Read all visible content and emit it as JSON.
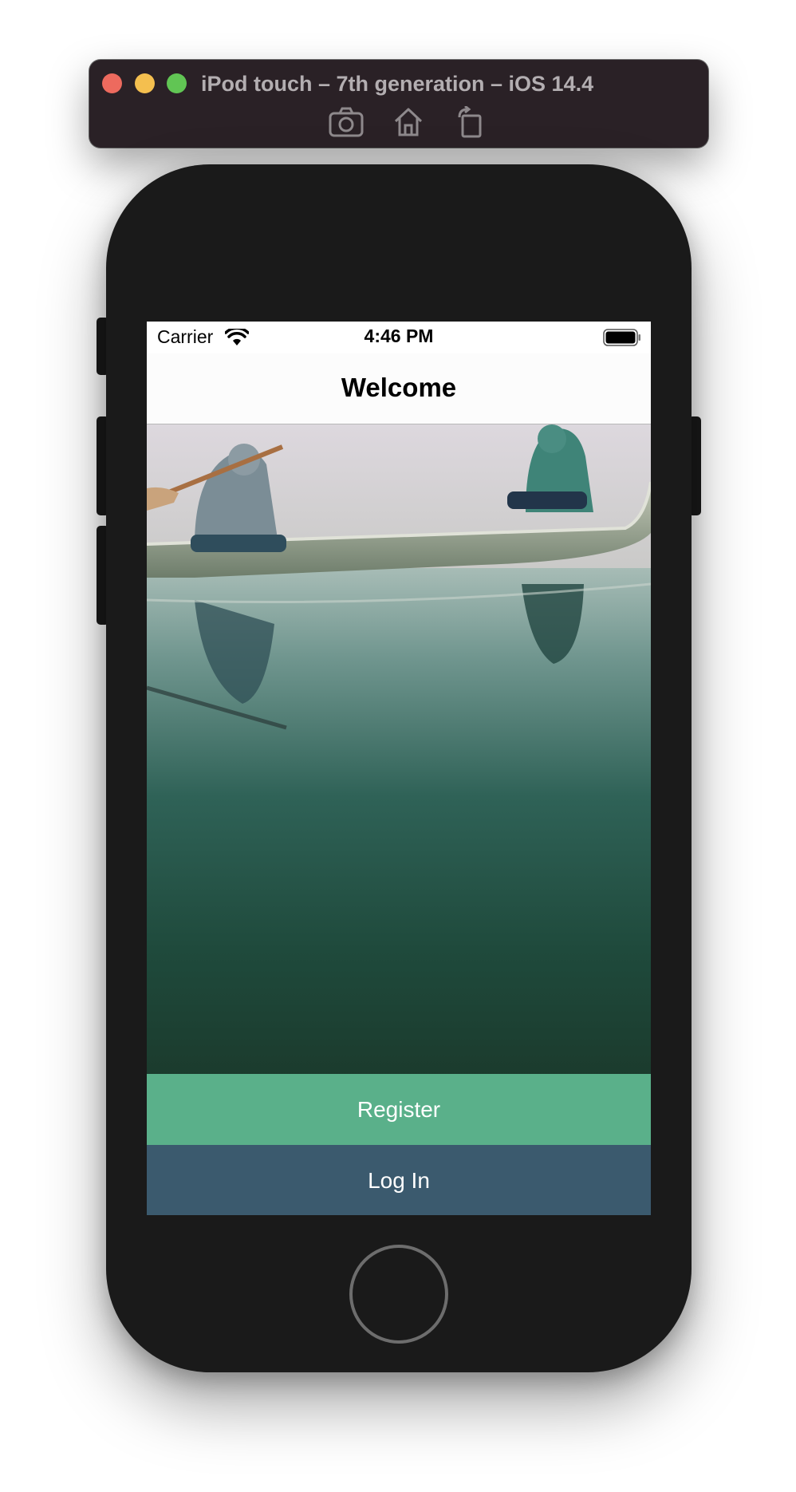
{
  "simulator": {
    "title": "iPod touch – 7th generation – iOS 14.4",
    "tools": [
      "camera-icon",
      "home-icon",
      "rotate-icon"
    ]
  },
  "status_bar": {
    "carrier": "Carrier",
    "time": "4:46 PM"
  },
  "nav": {
    "title": "Welcome"
  },
  "actions": {
    "register_label": "Register",
    "login_label": "Log In"
  },
  "colors": {
    "register": "#5ab08a",
    "login": "#3b5a6e",
    "device": "#1a1a1a"
  }
}
